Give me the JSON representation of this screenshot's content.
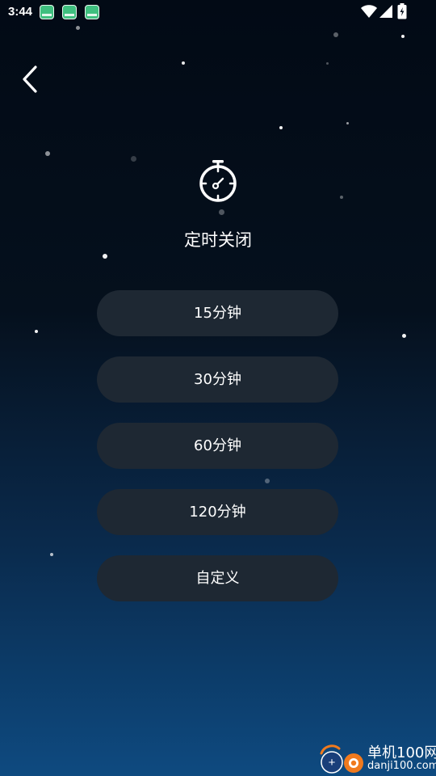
{
  "status_bar": {
    "time": "3:44",
    "notification_icons": [
      "app-notification-icon",
      "app-notification-icon",
      "app-notification-icon"
    ],
    "right_icons": [
      "wifi-icon",
      "signal-icon",
      "battery-charging-icon"
    ]
  },
  "header": {
    "back_icon": "chevron-left-icon"
  },
  "main": {
    "icon": "stopwatch-icon",
    "title": "定时关闭",
    "options": [
      {
        "label": "15分钟"
      },
      {
        "label": "30分钟"
      },
      {
        "label": "60分钟"
      },
      {
        "label": "120分钟"
      },
      {
        "label": "自定义"
      }
    ]
  },
  "watermark": {
    "name": "单机100网",
    "url": "danji100.com"
  },
  "colors": {
    "background_top": "#020a15",
    "background_bottom": "#0e4a80",
    "button_bg": "#1e2833",
    "text": "#ffffff"
  }
}
